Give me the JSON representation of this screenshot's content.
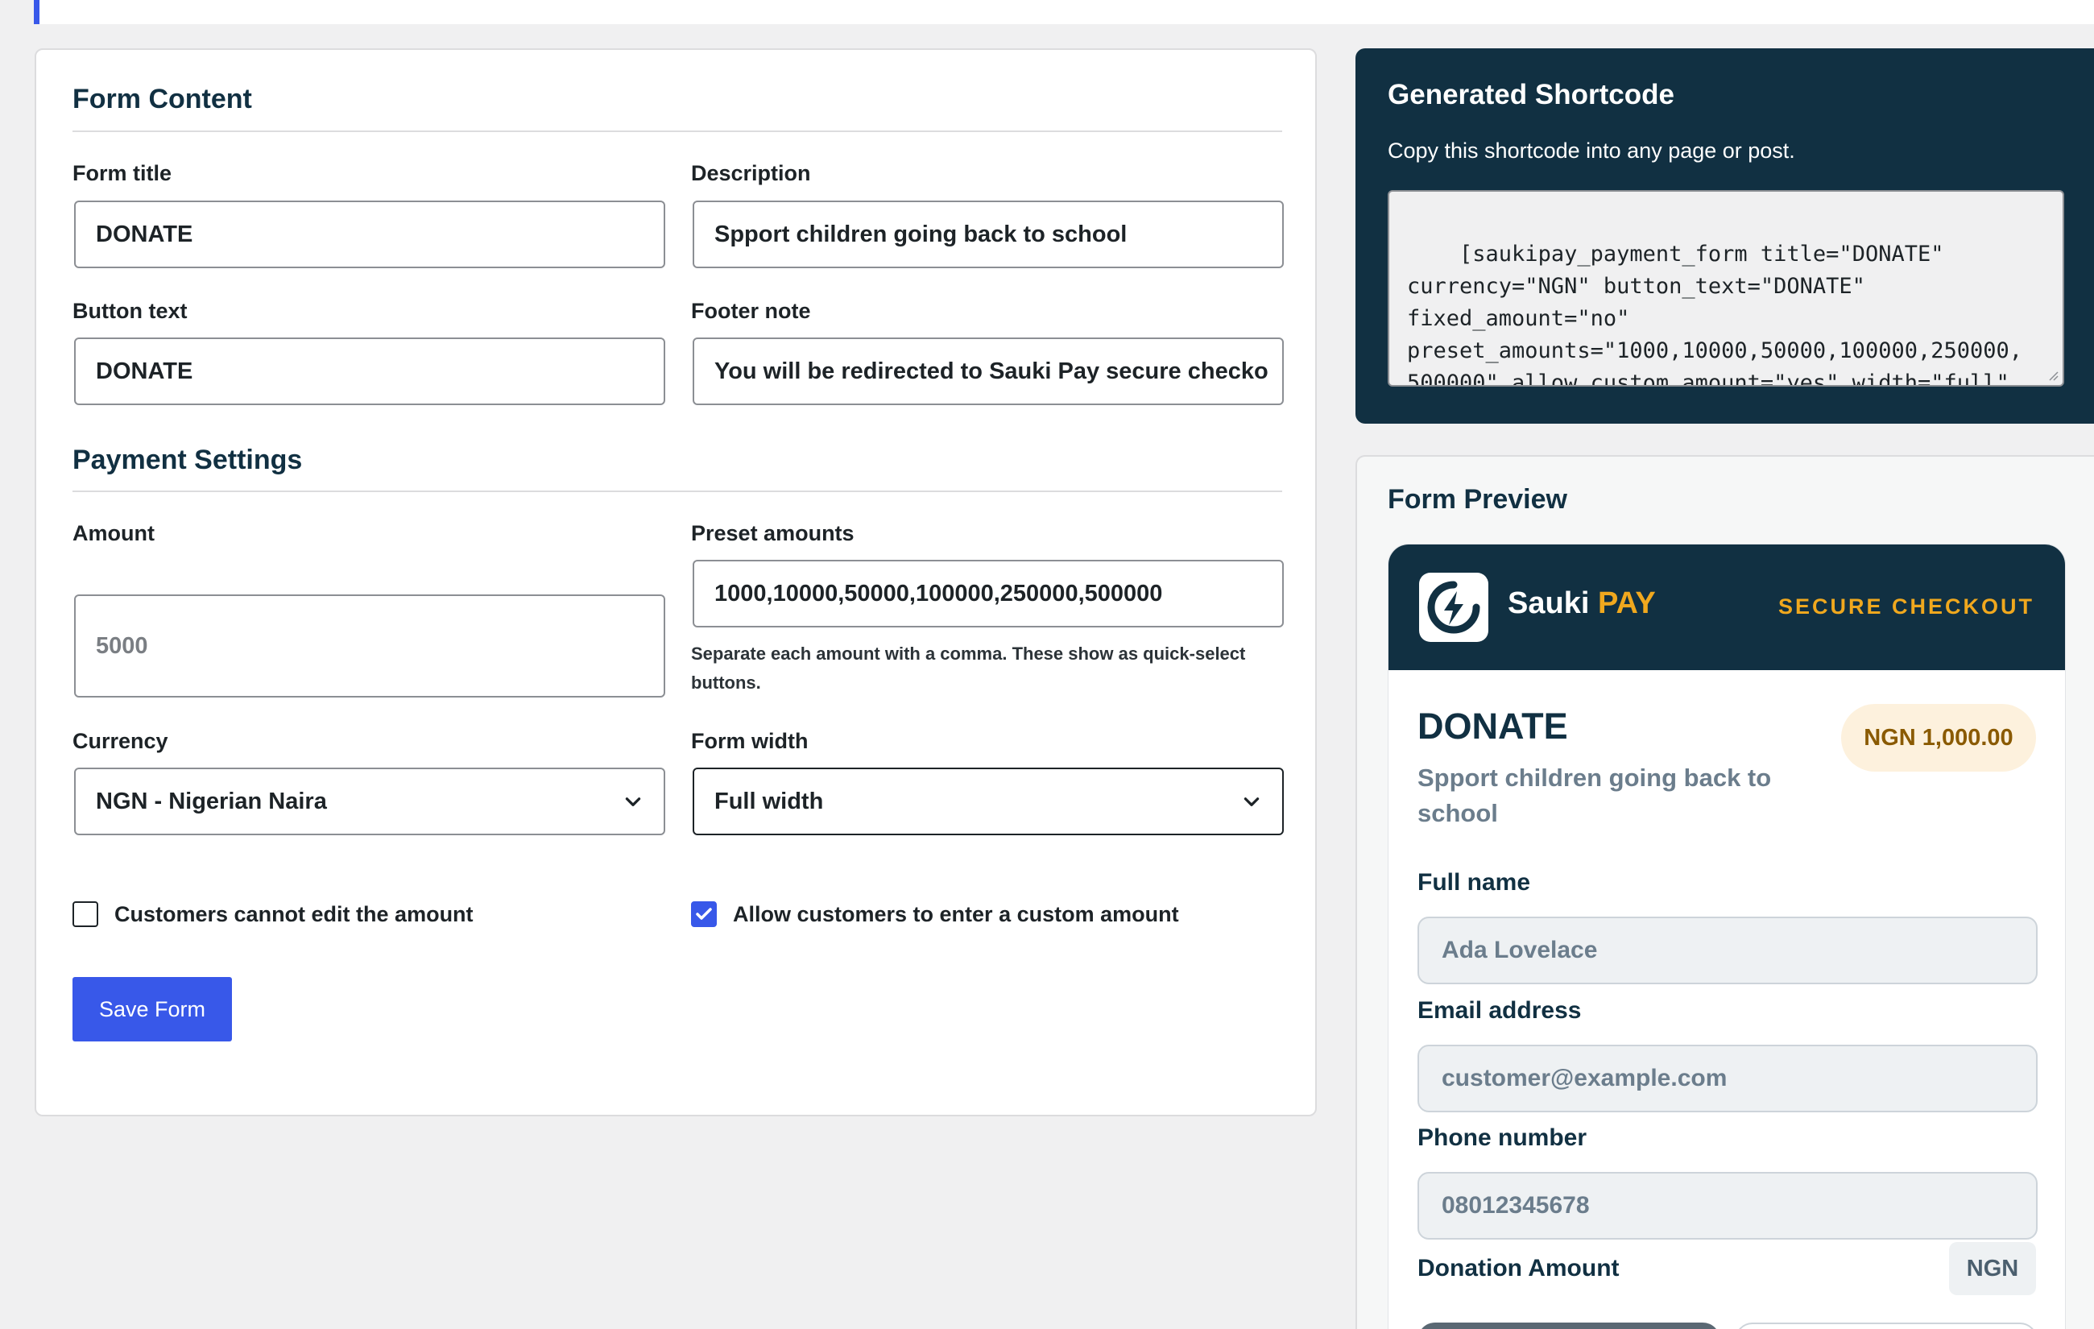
{
  "form": {
    "content_heading": "Form Content",
    "title_label": "Form title",
    "title_value": "DONATE",
    "description_label": "Description",
    "description_value": "Spport children going back to school",
    "button_text_label": "Button text",
    "button_text_value": "DONATE",
    "footer_note_label": "Footer note",
    "footer_note_value": "You will be redirected to Sauki Pay secure checko",
    "payment_heading": "Payment Settings",
    "amount_label": "Amount",
    "amount_placeholder": "5000",
    "preset_label": "Preset amounts",
    "preset_value": "1000,10000,50000,100000,250000,500000",
    "preset_help": "Separate each amount with a comma. These show as quick-select buttons.",
    "currency_label": "Currency",
    "currency_value": "NGN - Nigerian Naira",
    "width_label": "Form width",
    "width_value": "Full width",
    "fixed_amount_label": "Customers cannot edit the amount",
    "fixed_amount_checked": false,
    "custom_amount_label": "Allow customers to enter a custom amount",
    "custom_amount_checked": true,
    "save_label": "Save Form"
  },
  "shortcode": {
    "title": "Generated Shortcode",
    "subtitle": "Copy this shortcode into any page or post.",
    "code": "[saukipay_payment_form title=\"DONATE\"\ncurrency=\"NGN\" button_text=\"DONATE\"\nfixed_amount=\"no\"\npreset_amounts=\"1000,10000,50000,100000,250000,\n500000\" allow_custom_amount=\"yes\" width=\"full\"\ndescription=\"Spport children going back to"
  },
  "preview": {
    "title": "Form Preview",
    "brand_main": "Sauki",
    "brand_accent": "PAY",
    "secure_label": "SECURE CHECKOUT",
    "form_title": "DONATE",
    "description": "Spport children going back to school",
    "amount_badge": "NGN 1,000.00",
    "full_name_label": "Full name",
    "full_name_placeholder": "Ada Lovelace",
    "email_label": "Email address",
    "email_placeholder": "customer@example.com",
    "phone_label": "Phone number",
    "phone_placeholder": "08012345678",
    "donation_label": "Donation Amount",
    "currency_chip": "NGN"
  },
  "colors": {
    "accent": "#3858e9",
    "brand_dark": "#113042",
    "brand_gold": "#f0a81e"
  }
}
